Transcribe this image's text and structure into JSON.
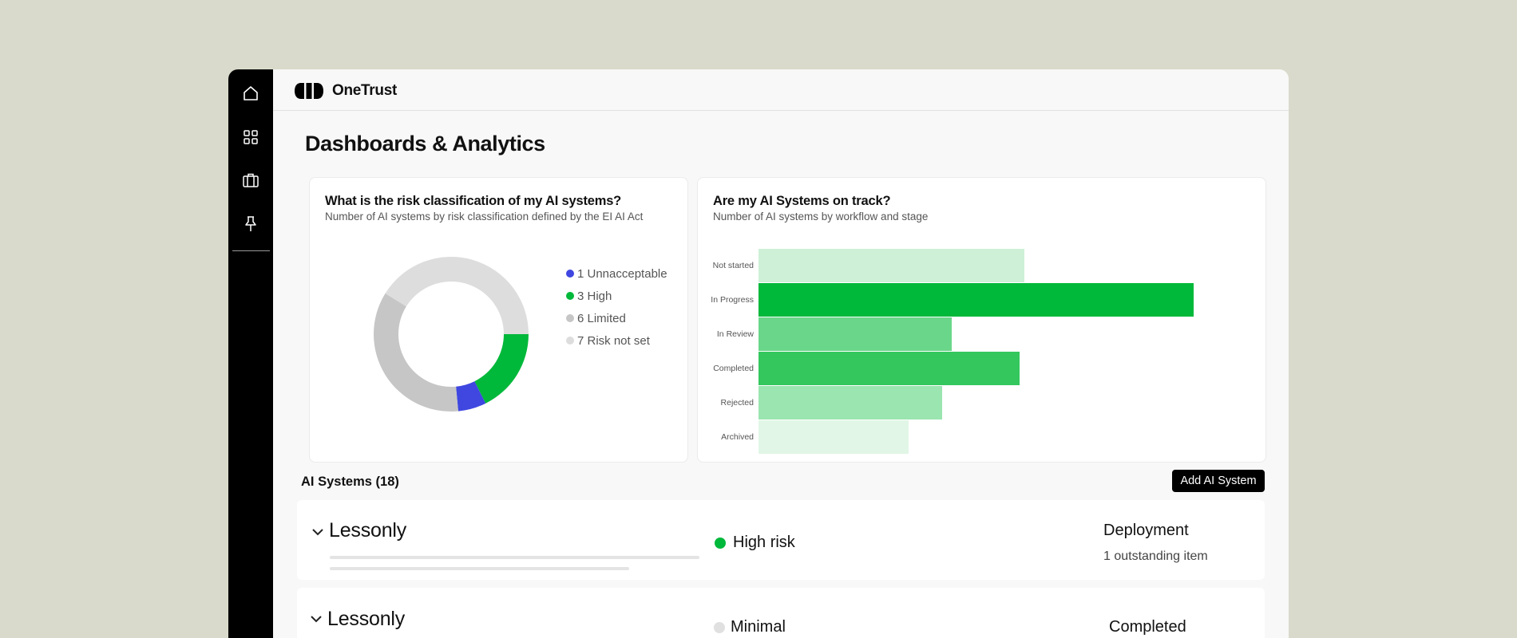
{
  "brand": {
    "name": "OneTrust"
  },
  "nav": [
    {
      "name": "home-icon"
    },
    {
      "name": "grid-icon"
    },
    {
      "name": "briefcase-icon"
    },
    {
      "name": "pin-icon"
    }
  ],
  "page": {
    "title": "Dashboards & Analytics"
  },
  "risk_card": {
    "title": "What is the risk classification of my AI systems?",
    "subtitle": "Number of AI systems by risk classification defined by the EI AI Act"
  },
  "track_card": {
    "title": "Are my AI Systems on track?",
    "subtitle": "Number of AI systems by workflow and stage"
  },
  "chart_data": [
    {
      "type": "pie",
      "style": "donut",
      "legend_position": "right",
      "slices": [
        {
          "label": "1 Unnacceptable",
          "value": 1,
          "color": "#3f47e0"
        },
        {
          "label": "3 High",
          "value": 3,
          "color": "#00b83a"
        },
        {
          "label": "6 Limited",
          "value": 6,
          "color": "#c6c6c6"
        },
        {
          "label": "7  Risk not set",
          "value": 7,
          "color": "#dddddd"
        }
      ]
    },
    {
      "type": "bar",
      "orientation": "horizontal",
      "categories": [
        "Not started",
        "In Progress",
        "In Review",
        "Completed",
        "Rejected",
        "Archived"
      ],
      "values": [
        5.5,
        9,
        4,
        5.4,
        3.8,
        3.1
      ],
      "colors": [
        "#cdf0d6",
        "#00b83a",
        "#6ad68a",
        "#34c75d",
        "#9ae5b0",
        "#e1f6e6"
      ],
      "xlim": [
        0,
        10
      ],
      "grid": false
    }
  ],
  "systems": {
    "title": "AI Systems (18)",
    "add_label": "Add AI System",
    "rows": [
      {
        "name": "Lessonly",
        "risk": "High risk",
        "risk_color": "#00b83a",
        "stage": "Deployment",
        "outstanding": "1 outstanding item"
      },
      {
        "name": "Lessonly",
        "risk": "Minimal",
        "risk_color": "#e0e0e0",
        "stage": "Completed"
      }
    ]
  }
}
